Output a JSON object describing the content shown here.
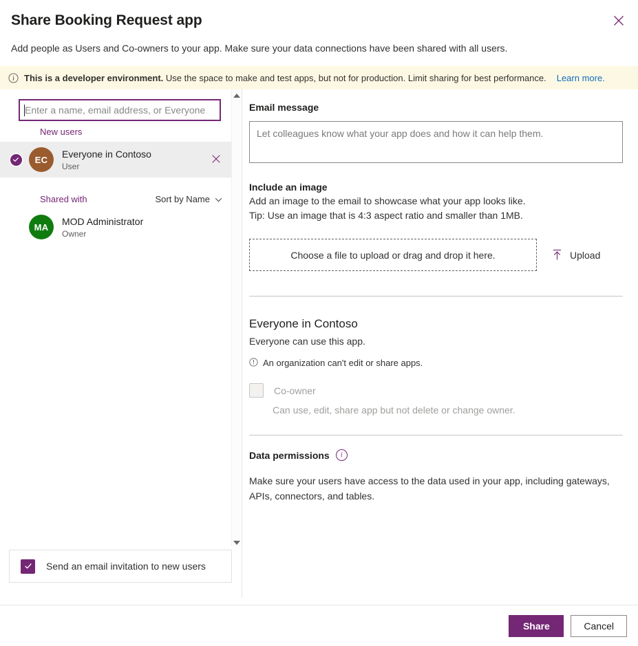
{
  "header": {
    "title": "Share Booking Request app",
    "subtitle": "Add people as Users and Co-owners to your app. Make sure your data connections have been shared with all users.",
    "close_icon": "close-icon"
  },
  "banner": {
    "icon": "info-icon",
    "strong_text": "This is a developer environment.",
    "rest_text": "Use the space to make and test apps, but not for production. Limit sharing for best performance.",
    "link_label": "Learn more.",
    "background": "#fdf8e3"
  },
  "left_pane": {
    "search": {
      "placeholder": "Enter a name, email address, or Everyone",
      "value": ""
    },
    "new_users_label": "New users",
    "shared_with_label": "Shared with",
    "sort_label": "Sort by Name",
    "sort_icon": "chevron-down-icon",
    "new_users": [
      {
        "initials": "EC",
        "name": "Everyone in Contoso",
        "role": "User",
        "avatar_color": "#9a5b2e",
        "selected": true,
        "remove_icon": "close-icon"
      }
    ],
    "shared_with": [
      {
        "initials": "MA",
        "name": "MOD Administrator",
        "role": "Owner",
        "avatar_color": "#107c10",
        "selected": false
      }
    ],
    "send_invite": {
      "label": "Send an email invitation to new users",
      "checked": true
    },
    "scrollbar": {
      "up_icon": "scroll-up-arrow-icon",
      "down_icon": "scroll-down-arrow-icon"
    }
  },
  "right_pane": {
    "email_message_label": "Email message",
    "email_message_placeholder": "Let colleagues know what your app does and how it can help them.",
    "email_message_value": "",
    "include_image_label": "Include an image",
    "include_image_line1": "Add an image to the email to showcase what your app looks like.",
    "include_image_line2": "Tip: Use an image that is 4:3 aspect ratio and smaller than 1MB.",
    "dropzone_label": "Choose a file to upload or drag and drop it here.",
    "upload_label": "Upload",
    "upload_icon": "upload-arrow-icon",
    "permission": {
      "title": "Everyone in Contoso",
      "subtitle": "Everyone can use this app.",
      "note_icon": "info-icon",
      "note": "An organization can't edit or share apps.",
      "coowner_label": "Co-owner",
      "coowner_checked": false,
      "coowner_description": "Can use, edit, share app but not delete or change owner."
    },
    "data_permissions": {
      "title": "Data permissions",
      "info_icon": "info-icon",
      "info_glyph": "i",
      "body": "Make sure your users have access to the data used in your app, including gateways, APIs, connectors, and tables."
    }
  },
  "footer": {
    "share_label": "Share",
    "cancel_label": "Cancel"
  },
  "theme": {
    "accent": "#742774",
    "link": "#0f6cbd",
    "banner_bg": "#fdf8e3"
  }
}
